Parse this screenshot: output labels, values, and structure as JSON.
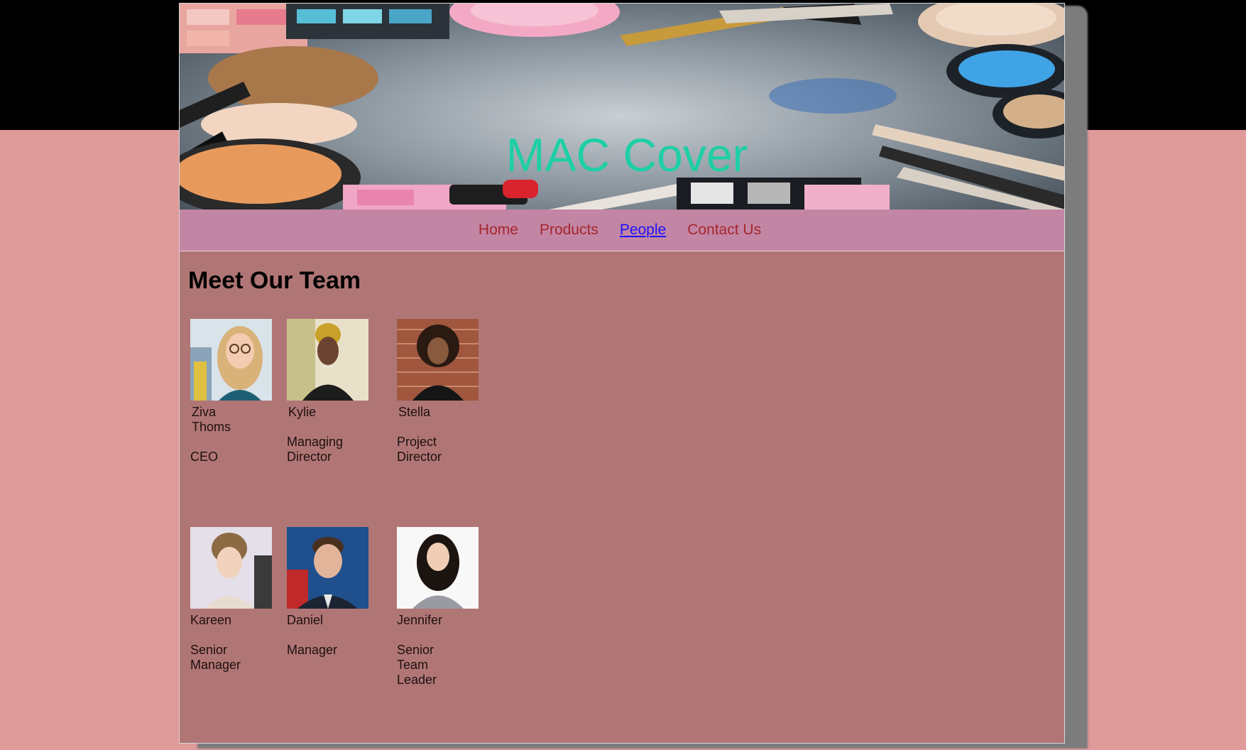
{
  "site": {
    "title": "MAC Cover"
  },
  "nav": {
    "items": [
      {
        "label": "Home",
        "active": false
      },
      {
        "label": "Products",
        "active": false
      },
      {
        "label": "People",
        "active": true
      },
      {
        "label": "Contact Us",
        "active": false
      }
    ],
    "link_color": "#a5262d",
    "active_color": "#1e10ff"
  },
  "main": {
    "heading": "Meet Our Team",
    "team": [
      {
        "name": "Ziva\nThoms",
        "role": "CEO",
        "photo_icon": "portrait-blonde-woman-glasses"
      },
      {
        "name": "Kylie",
        "role": "Managing\nDirector",
        "photo_icon": "portrait-woman-headwrap"
      },
      {
        "name": "Stella",
        "role": "Project\nDirector",
        "photo_icon": "portrait-woman-curly-hair"
      },
      {
        "name": "Kareen",
        "role": "Senior\nManager",
        "photo_icon": "portrait-woman-updo"
      },
      {
        "name": "Daniel",
        "role": "Manager",
        "photo_icon": "portrait-man-suit"
      },
      {
        "name": "Jennifer",
        "role": "Senior\nTeam\nLeader",
        "photo_icon": "portrait-woman-dark-hair"
      }
    ]
  },
  "colors": {
    "background": "#df9a9a",
    "page": "#b07675",
    "nav_bar": "#c385a4",
    "title": "#1ecfa5"
  }
}
